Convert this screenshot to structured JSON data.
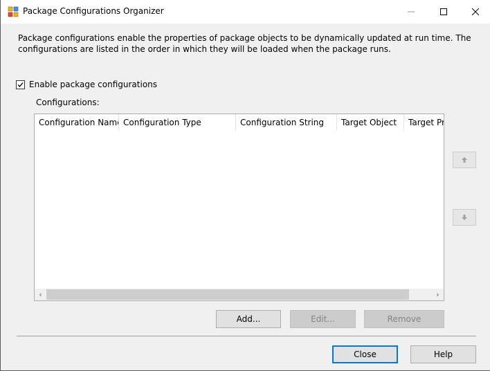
{
  "window": {
    "title": "Package Configurations Organizer"
  },
  "description": "Package configurations enable the properties of package objects to be dynamically updated at run time. The configurations are listed in the order in which they will be loaded when the package runs.",
  "enable_checkbox": {
    "label": "Enable package configurations",
    "checked": true
  },
  "configurations_label": "Configurations:",
  "columns": [
    "Configuration Name",
    "Configuration Type",
    "Configuration String",
    "Target Object",
    "Target Pro"
  ],
  "rows": [],
  "buttons": {
    "add": "Add...",
    "edit": "Edit...",
    "remove": "Remove",
    "close": "Close",
    "help": "Help"
  },
  "colors": {
    "dialog_bg": "#f0f0f0",
    "accent": "#0078d7",
    "disabled_text": "#838383"
  }
}
